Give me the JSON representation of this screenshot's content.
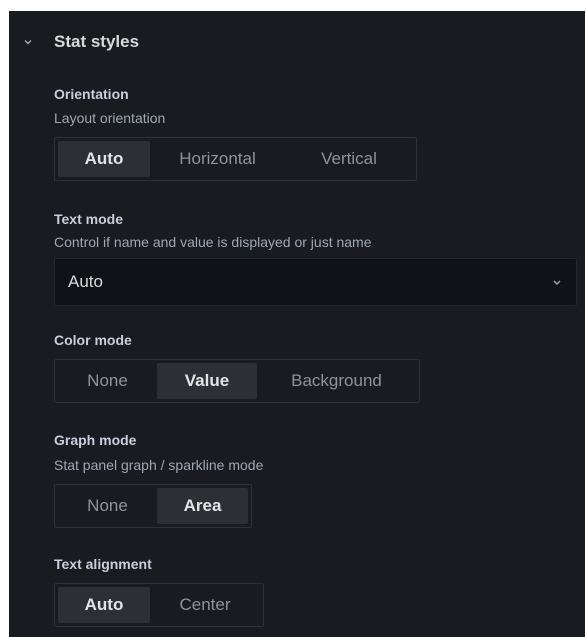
{
  "section": {
    "title": "Stat styles"
  },
  "orientation": {
    "label": "Orientation",
    "description": "Layout orientation",
    "options": [
      "Auto",
      "Horizontal",
      "Vertical"
    ],
    "selected": "Auto"
  },
  "text_mode": {
    "label": "Text mode",
    "description": "Control if name and value is displayed or just name",
    "value": "Auto"
  },
  "color_mode": {
    "label": "Color mode",
    "options": [
      "None",
      "Value",
      "Background"
    ],
    "selected": "Value"
  },
  "graph_mode": {
    "label": "Graph mode",
    "description": "Stat panel graph / sparkline mode",
    "options": [
      "None",
      "Area"
    ],
    "selected": "Area"
  },
  "text_alignment": {
    "label": "Text alignment",
    "options": [
      "Auto",
      "Center"
    ],
    "selected": "Auto"
  },
  "colors": {
    "panel_bg": "#181b1f",
    "active_option_bg": "#2d2f34",
    "select_bg": "#111217"
  },
  "icons": {
    "section_toggle": "chevron-down-icon",
    "select_caret": "chevron-down-icon"
  }
}
